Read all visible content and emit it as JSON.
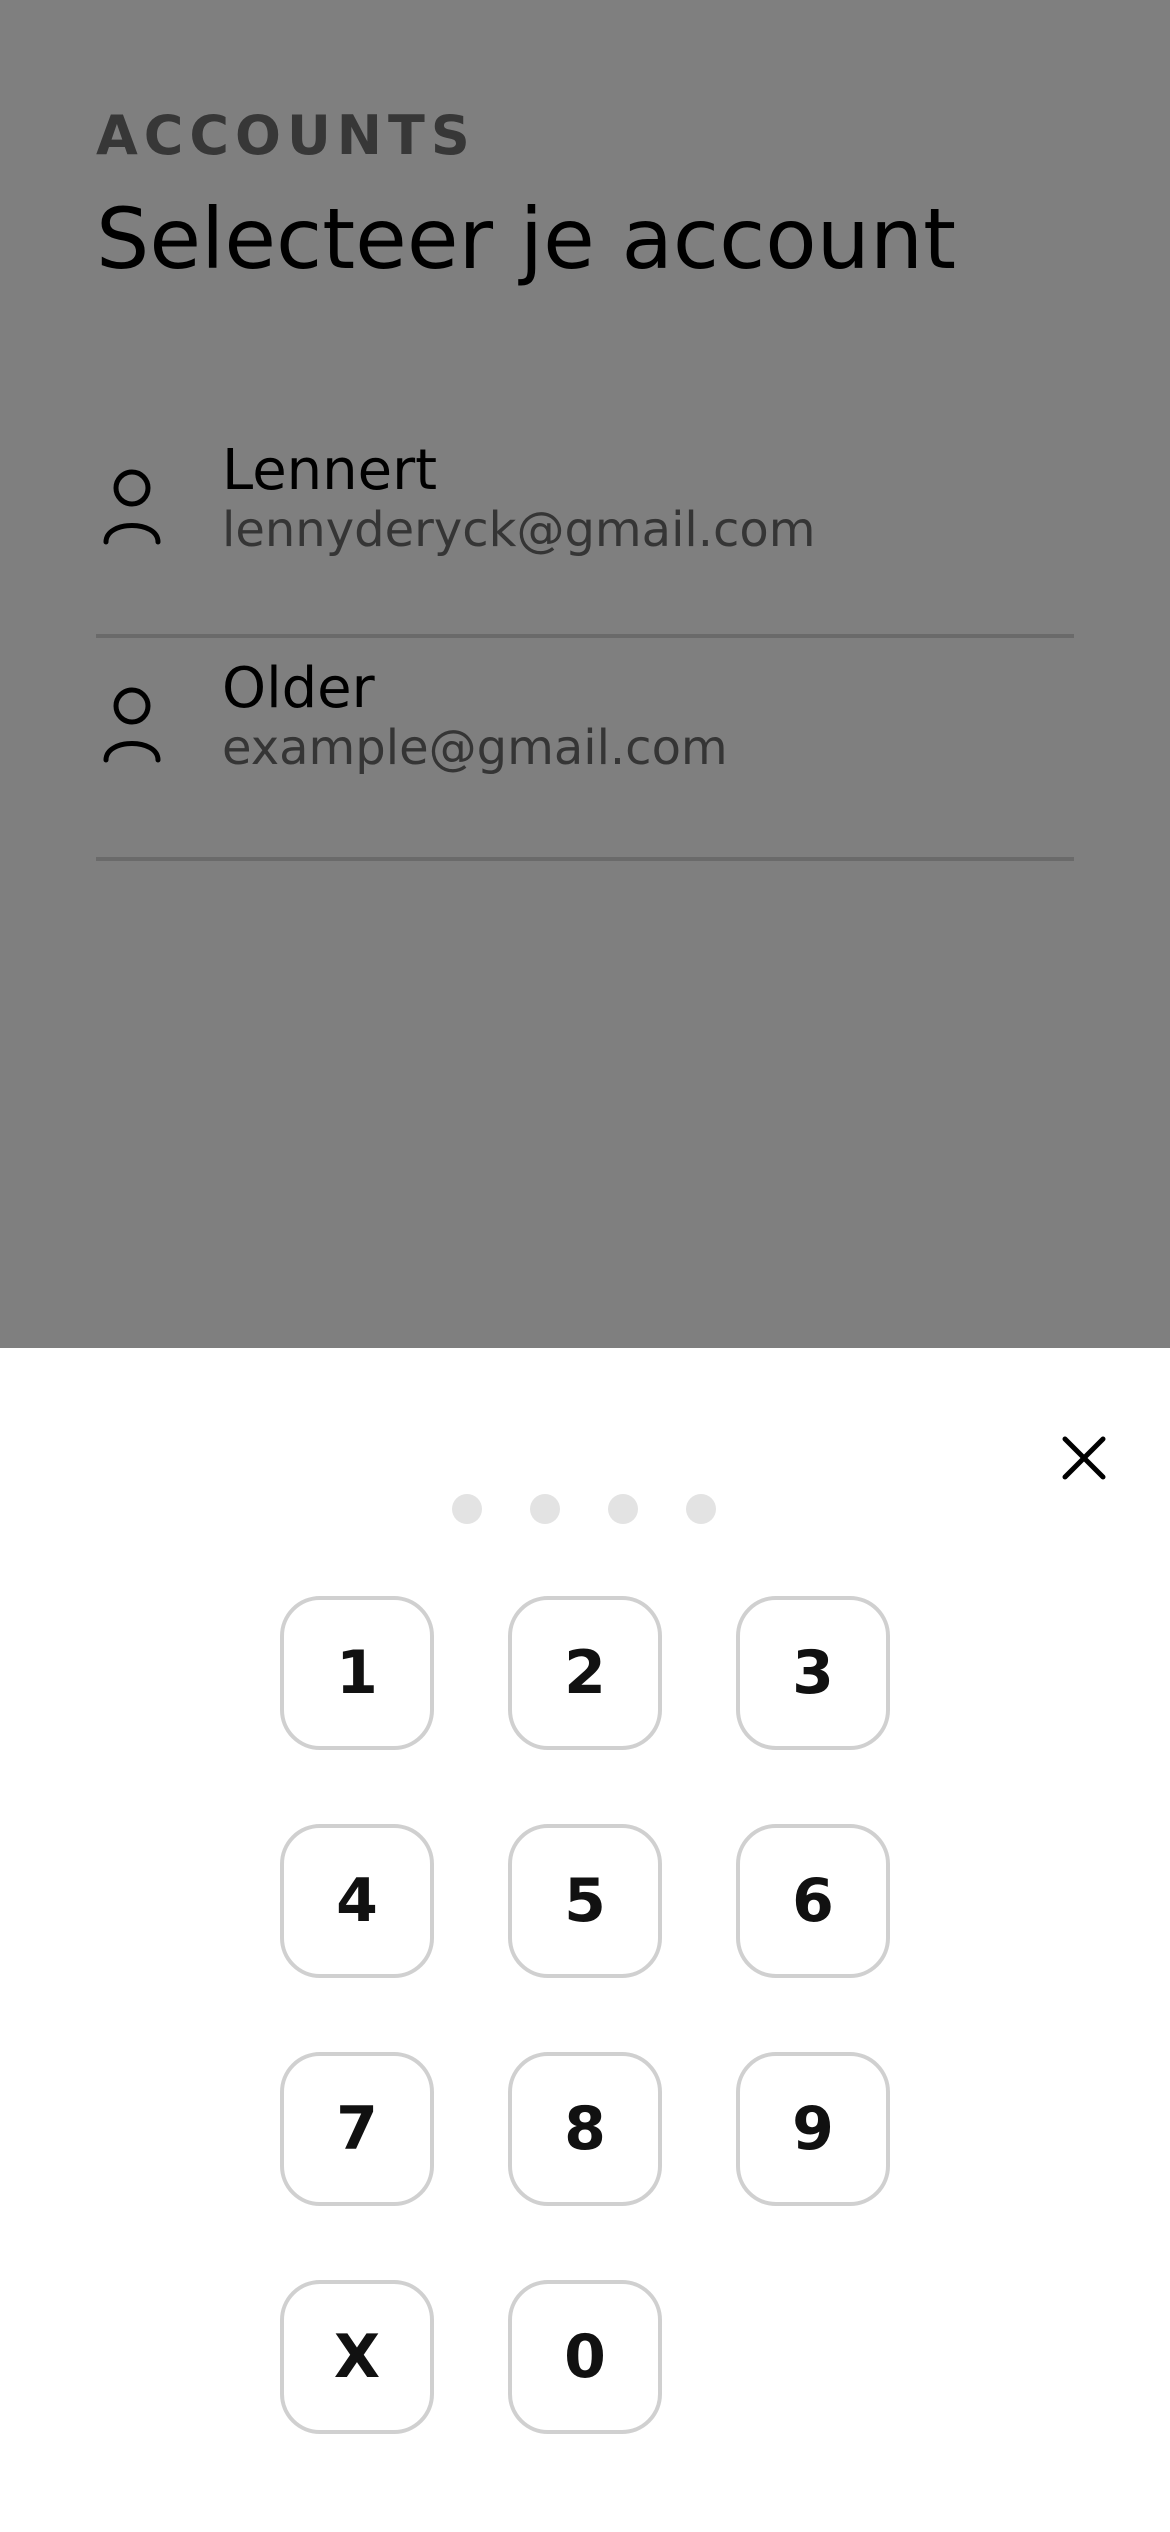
{
  "header": {
    "section_label": "ACCOUNTS",
    "title": "Selecteer je account"
  },
  "accounts": [
    {
      "name": "Lennert",
      "email": "lennyderyck@gmail.com",
      "icon": "person-icon"
    },
    {
      "name": "Older",
      "email": "example@gmail.com",
      "icon": "person-icon"
    }
  ],
  "pin_sheet": {
    "close_icon": "close-icon",
    "dots_filled": 0,
    "dots_total": 4,
    "keys": [
      "1",
      "2",
      "3",
      "4",
      "5",
      "6",
      "7",
      "8",
      "9",
      "X",
      "0"
    ]
  },
  "colors": {
    "overlay": "#000000",
    "dot_empty": "#e3e3e3",
    "key_border": "#d0d0d0",
    "divider": "#d4d4d4"
  }
}
